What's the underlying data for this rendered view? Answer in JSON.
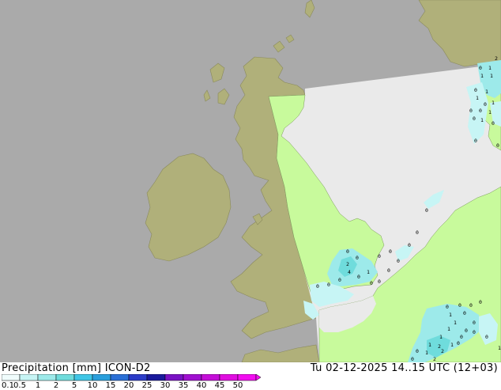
{
  "title": {
    "left": "Precipitation [mm]  ICON-D2",
    "right": "Tu 02-12-2025 14..15 UTC (12+03)"
  },
  "legend": {
    "ticks": [
      "0.1",
      "0.5",
      "1",
      "2",
      "5",
      "10",
      "15",
      "20",
      "25",
      "30",
      "35",
      "40",
      "45",
      "50"
    ],
    "colors": [
      "#f0fcfc",
      "#c7f5f5",
      "#9deaea",
      "#6fdcdc",
      "#3fc6e6",
      "#2a9fdc",
      "#2a6fd6",
      "#2c3cc8",
      "#1a1a9c",
      "#7a12c4",
      "#a010d0",
      "#c40ed8",
      "#e00ee0",
      "#f20ef0"
    ]
  },
  "colors": {
    "sea": "#aaaaaa",
    "land_outside": "#b0b07a",
    "domain_sea": "#eaeaea",
    "domain_land": "#c8fa9c",
    "precip_light": "#c7f5f5",
    "precip_medium": "#9deaea",
    "precip_strong": "#6fdcdc",
    "coastline": "#8a8a5c"
  },
  "map_labels": [
    {
      "text": "2"
    },
    {
      "text": "0"
    },
    {
      "text": "1"
    },
    {
      "text": "1"
    },
    {
      "text": "1"
    },
    {
      "text": "0"
    },
    {
      "text": "1"
    },
    {
      "text": "1"
    },
    {
      "text": "0"
    },
    {
      "text": "1"
    },
    {
      "text": "0"
    },
    {
      "text": "0"
    },
    {
      "text": "1"
    },
    {
      "text": "0"
    },
    {
      "text": "1"
    },
    {
      "text": "0"
    },
    {
      "text": "0"
    },
    {
      "text": "0"
    },
    {
      "text": "0"
    },
    {
      "text": "0"
    },
    {
      "text": "0"
    },
    {
      "text": "0"
    },
    {
      "text": "0"
    },
    {
      "text": "0"
    },
    {
      "text": "2"
    },
    {
      "text": "0"
    },
    {
      "text": "4"
    },
    {
      "text": "0"
    },
    {
      "text": "0"
    },
    {
      "text": "0"
    },
    {
      "text": "1"
    },
    {
      "text": "0"
    },
    {
      "text": "0"
    },
    {
      "text": "0"
    },
    {
      "text": "0"
    },
    {
      "text": "0"
    },
    {
      "text": "0"
    },
    {
      "text": "0"
    },
    {
      "text": "0"
    },
    {
      "text": "0"
    },
    {
      "text": "0"
    },
    {
      "text": "0"
    },
    {
      "text": "1"
    },
    {
      "text": "1"
    },
    {
      "text": "0"
    },
    {
      "text": "1"
    },
    {
      "text": "0"
    },
    {
      "text": "1"
    },
    {
      "text": "2"
    },
    {
      "text": "1"
    },
    {
      "text": "2"
    },
    {
      "text": "1"
    },
    {
      "text": "2"
    },
    {
      "text": "0"
    },
    {
      "text": "0"
    },
    {
      "text": "0"
    },
    {
      "text": "1"
    },
    {
      "text": "0"
    },
    {
      "text": "1"
    },
    {
      "text": "0"
    }
  ]
}
